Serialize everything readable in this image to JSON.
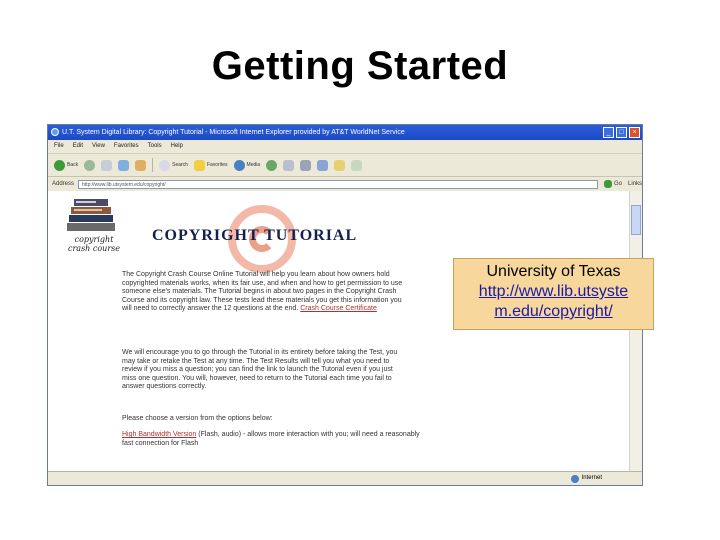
{
  "slide": {
    "title": "Getting Started"
  },
  "browser": {
    "window_title": "U.T. System Digital Library: Copyright Tutorial - Microsoft Internet Explorer provided by AT&T WorldNet Service",
    "menu": [
      "File",
      "Edit",
      "View",
      "Favorites",
      "Tools",
      "Help"
    ],
    "toolbar": {
      "back_label": "Back",
      "search_label": "Search",
      "favorites_label": "Favorites",
      "media_label": "Media"
    },
    "address_label": "Address",
    "address_value": "http://www.lib.utsystem.edu/copyright/",
    "go_label": "Go",
    "links_label": "Links",
    "status_zone": "Internet"
  },
  "page": {
    "logo_text_line1": "copyright",
    "logo_text_line2": "crash course",
    "tutorial_title": "COPYRIGHT TUTORIAL",
    "para1": "The Copyright Crash Course Online Tutorial will help you learn about how owners hold copyrighted materials works, when its fair use, and when and how to get permission to use someone else's materials. The Tutorial begins in about two pages in the Copyright Crash Course and its copyright law. These tests lead these materials you get this information you will need to correctly answer the 12 questions at the end. ",
    "para1_link": "Crash Course Certificate",
    "para2": "We will encourage you to go through the Tutorial in its entirety before taking the Test, you may take or retake the Test at any time. The Test Results will tell you what you need to review if you miss a question; you can find the link to launch the Tutorial even if you just miss one question. You will, however, need to return to the Tutorial each time you fail to answer questions correctly.",
    "para3": "Please choose a version from the options below:",
    "option_link": "High Bandwidth Version",
    "option_text": " (Flash, audio) - allows more interaction with you; will need a reasonably fast connection for Flash"
  },
  "callout": {
    "name": "University of Texas",
    "url": "http://www.lib.utsystem.edu/copyright/",
    "url_line1": "http://www.lib.utsyste",
    "url_line2": "m.edu/copyright/"
  },
  "colors": {
    "callout_bg": "#f7d79b",
    "titlebar": "#1c49c4",
    "link": "#1a1aa6"
  }
}
